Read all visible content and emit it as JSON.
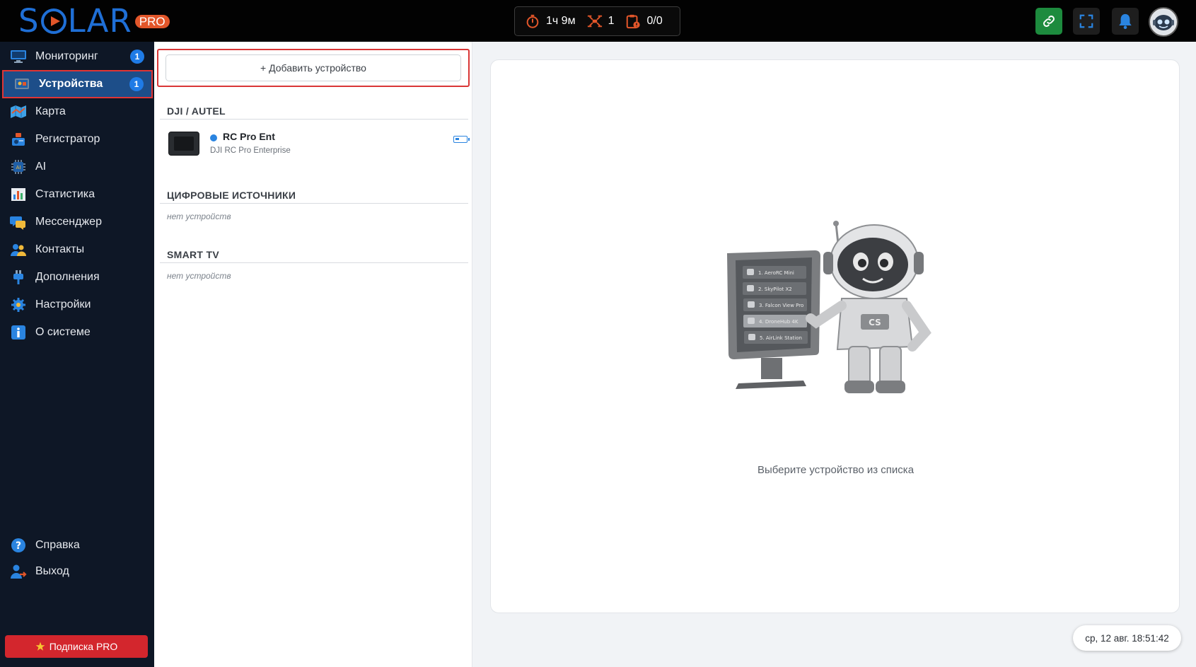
{
  "app": {
    "logo_text": "SOLAR",
    "logo_badge": "PRO"
  },
  "header": {
    "stats": [
      {
        "icon": "timer-icon",
        "value": "1ч 9м"
      },
      {
        "icon": "drone-icon",
        "value": "1"
      },
      {
        "icon": "clipboard-alert-icon",
        "value": "0/0"
      }
    ],
    "colors": {
      "stat_icon": "#e2562a",
      "link_button": "#1d8b3e",
      "bell": "#2a84e0"
    }
  },
  "sidebar": {
    "items": [
      {
        "label": "Мониторинг",
        "icon": "monitor-icon",
        "badge": "1"
      },
      {
        "label": "Устройства",
        "icon": "devices-icon",
        "badge": "1",
        "active": true
      },
      {
        "label": "Карта",
        "icon": "map-icon"
      },
      {
        "label": "Регистратор",
        "icon": "registrar-icon"
      },
      {
        "label": "AI",
        "icon": "ai-chip-icon"
      },
      {
        "label": "Статистика",
        "icon": "statistics-icon"
      },
      {
        "label": "Мессенджер",
        "icon": "messenger-icon"
      },
      {
        "label": "Контакты",
        "icon": "contacts-icon"
      },
      {
        "label": "Дополнения",
        "icon": "addons-icon"
      },
      {
        "label": "Настройки",
        "icon": "settings-gear-icon"
      },
      {
        "label": "О системе",
        "icon": "info-icon"
      }
    ],
    "bottom_items": [
      {
        "label": "Справка",
        "icon": "help-icon"
      },
      {
        "label": "Выход",
        "icon": "logout-icon"
      }
    ],
    "subscription_button": "Подписка PRO"
  },
  "devices": {
    "add_button": "+ Добавить устройство",
    "sections": [
      {
        "title": "DJI / AUTEL"
      },
      {
        "title": "ЦИФРОВЫЕ ИСТОЧНИКИ",
        "empty_text": "нет устройств"
      },
      {
        "title": "SMART TV",
        "empty_text": "нет устройств"
      }
    ],
    "device": {
      "name": "RC Pro Ent",
      "model": "DJI RC Pro Enterprise",
      "status_color": "#2a84e0"
    }
  },
  "main": {
    "illustration_list": [
      "1. AeroRC Mini",
      "2. SkyPilot X2",
      "3. Falcon View Pro",
      "4. DroneHub 4K",
      "5. AirLink Station"
    ],
    "robot_chest_label": "CS",
    "hint": "Выберите устройство из списка",
    "clock": "ср, 12 авг. 18:51:42"
  }
}
